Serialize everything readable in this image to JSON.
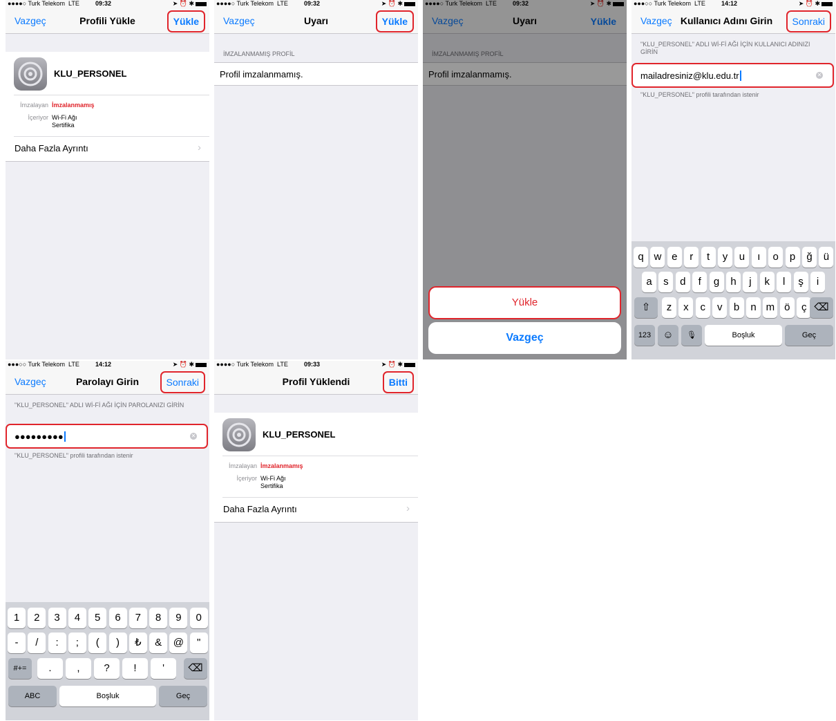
{
  "status": {
    "carrier_a": "●●●●○ Turk Telekom  LTE",
    "carrier_b": "●●●○○ Turk Telekom  LTE",
    "time_install": "09:32",
    "time_login": "14:12",
    "time_done": "09:33",
    "icons": "➤ ⏰ ✱"
  },
  "common": {
    "cancel": "Vazgeç",
    "install": "Yükle",
    "next": "Sonraki",
    "profile_name": "KLU_PERSONEL",
    "signed_by_label": "İmzalayan",
    "signed_by_value": "İmzalanmamış",
    "contains_label": "İçeriyor",
    "contains_line1": "Wi-Fi Ağı",
    "contains_line2": "Sertifika",
    "more_details": "Daha Fazla Ayrıntı",
    "chevron": "›",
    "unsigned_header": "İMZALANMAMIŞ PROFİL",
    "unsigned_text": "Profil imzalanmamış.",
    "requested_by": "\"KLU_PERSONEL\" profili tarafından istenir",
    "clear": "✕"
  },
  "screen1": {
    "title": "Profili Yükle"
  },
  "screen2": {
    "title": "Uyarı"
  },
  "screen3": {
    "title": "Uyarı",
    "sheet_install": "Yükle",
    "sheet_cancel": "Vazgeç"
  },
  "screen4": {
    "title": "Kullanıcı Adını Girin",
    "hint": "\"KLU_PERSONEL\" ADLI Wİ-Fİ AĞI İÇİN KULLANICI ADINIZI GİRİN",
    "value": "mailadresiniz@klu.edu.tr",
    "row1": [
      "q",
      "w",
      "e",
      "r",
      "t",
      "y",
      "u",
      "ı",
      "o",
      "p",
      "ğ",
      "ü"
    ],
    "row2": [
      "a",
      "s",
      "d",
      "f",
      "g",
      "h",
      "j",
      "k",
      "l",
      "ş",
      "i"
    ],
    "row3": [
      "z",
      "x",
      "c",
      "v",
      "b",
      "n",
      "m",
      "ö",
      "ç"
    ],
    "shift": "⇧",
    "backspace": "⌫",
    "mode": "123",
    "emoji": "☺",
    "mic": "🎙",
    "space": "Boşluk",
    "go": "Geç"
  },
  "screen5": {
    "title": "Parolayı Girin",
    "hint": "\"KLU_PERSONEL\" ADLI Wİ-Fİ AĞI İÇİN PAROLANIZI GİRİN",
    "value": "●●●●●●●●●",
    "row1": [
      "1",
      "2",
      "3",
      "4",
      "5",
      "6",
      "7",
      "8",
      "9",
      "0"
    ],
    "row2": [
      "-",
      "/",
      ":",
      ";",
      "(",
      ")",
      "₺",
      "&",
      "@",
      "\""
    ],
    "row3": [
      ".",
      ",",
      "?",
      "!",
      "'"
    ],
    "symbols": "#+=",
    "backspace": "⌫",
    "abc": "ABC",
    "space": "Boşluk",
    "go": "Geç"
  },
  "screen6": {
    "title": "Profil Yüklendi",
    "done": "Bitti"
  }
}
